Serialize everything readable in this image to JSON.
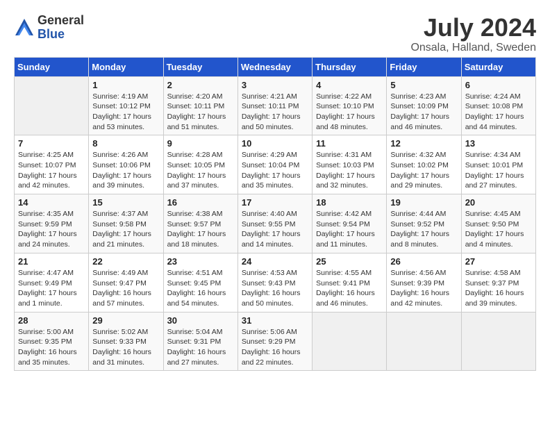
{
  "logo": {
    "general": "General",
    "blue": "Blue"
  },
  "title": {
    "month_year": "July 2024",
    "location": "Onsala, Halland, Sweden"
  },
  "days_of_week": [
    "Sunday",
    "Monday",
    "Tuesday",
    "Wednesday",
    "Thursday",
    "Friday",
    "Saturday"
  ],
  "weeks": [
    [
      {
        "day": "",
        "info": ""
      },
      {
        "day": "1",
        "info": "Sunrise: 4:19 AM\nSunset: 10:12 PM\nDaylight: 17 hours\nand 53 minutes."
      },
      {
        "day": "2",
        "info": "Sunrise: 4:20 AM\nSunset: 10:11 PM\nDaylight: 17 hours\nand 51 minutes."
      },
      {
        "day": "3",
        "info": "Sunrise: 4:21 AM\nSunset: 10:11 PM\nDaylight: 17 hours\nand 50 minutes."
      },
      {
        "day": "4",
        "info": "Sunrise: 4:22 AM\nSunset: 10:10 PM\nDaylight: 17 hours\nand 48 minutes."
      },
      {
        "day": "5",
        "info": "Sunrise: 4:23 AM\nSunset: 10:09 PM\nDaylight: 17 hours\nand 46 minutes."
      },
      {
        "day": "6",
        "info": "Sunrise: 4:24 AM\nSunset: 10:08 PM\nDaylight: 17 hours\nand 44 minutes."
      }
    ],
    [
      {
        "day": "7",
        "info": "Sunrise: 4:25 AM\nSunset: 10:07 PM\nDaylight: 17 hours\nand 42 minutes."
      },
      {
        "day": "8",
        "info": "Sunrise: 4:26 AM\nSunset: 10:06 PM\nDaylight: 17 hours\nand 39 minutes."
      },
      {
        "day": "9",
        "info": "Sunrise: 4:28 AM\nSunset: 10:05 PM\nDaylight: 17 hours\nand 37 minutes."
      },
      {
        "day": "10",
        "info": "Sunrise: 4:29 AM\nSunset: 10:04 PM\nDaylight: 17 hours\nand 35 minutes."
      },
      {
        "day": "11",
        "info": "Sunrise: 4:31 AM\nSunset: 10:03 PM\nDaylight: 17 hours\nand 32 minutes."
      },
      {
        "day": "12",
        "info": "Sunrise: 4:32 AM\nSunset: 10:02 PM\nDaylight: 17 hours\nand 29 minutes."
      },
      {
        "day": "13",
        "info": "Sunrise: 4:34 AM\nSunset: 10:01 PM\nDaylight: 17 hours\nand 27 minutes."
      }
    ],
    [
      {
        "day": "14",
        "info": "Sunrise: 4:35 AM\nSunset: 9:59 PM\nDaylight: 17 hours\nand 24 minutes."
      },
      {
        "day": "15",
        "info": "Sunrise: 4:37 AM\nSunset: 9:58 PM\nDaylight: 17 hours\nand 21 minutes."
      },
      {
        "day": "16",
        "info": "Sunrise: 4:38 AM\nSunset: 9:57 PM\nDaylight: 17 hours\nand 18 minutes."
      },
      {
        "day": "17",
        "info": "Sunrise: 4:40 AM\nSunset: 9:55 PM\nDaylight: 17 hours\nand 14 minutes."
      },
      {
        "day": "18",
        "info": "Sunrise: 4:42 AM\nSunset: 9:54 PM\nDaylight: 17 hours\nand 11 minutes."
      },
      {
        "day": "19",
        "info": "Sunrise: 4:44 AM\nSunset: 9:52 PM\nDaylight: 17 hours\nand 8 minutes."
      },
      {
        "day": "20",
        "info": "Sunrise: 4:45 AM\nSunset: 9:50 PM\nDaylight: 17 hours\nand 4 minutes."
      }
    ],
    [
      {
        "day": "21",
        "info": "Sunrise: 4:47 AM\nSunset: 9:49 PM\nDaylight: 17 hours\nand 1 minute."
      },
      {
        "day": "22",
        "info": "Sunrise: 4:49 AM\nSunset: 9:47 PM\nDaylight: 16 hours\nand 57 minutes."
      },
      {
        "day": "23",
        "info": "Sunrise: 4:51 AM\nSunset: 9:45 PM\nDaylight: 16 hours\nand 54 minutes."
      },
      {
        "day": "24",
        "info": "Sunrise: 4:53 AM\nSunset: 9:43 PM\nDaylight: 16 hours\nand 50 minutes."
      },
      {
        "day": "25",
        "info": "Sunrise: 4:55 AM\nSunset: 9:41 PM\nDaylight: 16 hours\nand 46 minutes."
      },
      {
        "day": "26",
        "info": "Sunrise: 4:56 AM\nSunset: 9:39 PM\nDaylight: 16 hours\nand 42 minutes."
      },
      {
        "day": "27",
        "info": "Sunrise: 4:58 AM\nSunset: 9:37 PM\nDaylight: 16 hours\nand 39 minutes."
      }
    ],
    [
      {
        "day": "28",
        "info": "Sunrise: 5:00 AM\nSunset: 9:35 PM\nDaylight: 16 hours\nand 35 minutes."
      },
      {
        "day": "29",
        "info": "Sunrise: 5:02 AM\nSunset: 9:33 PM\nDaylight: 16 hours\nand 31 minutes."
      },
      {
        "day": "30",
        "info": "Sunrise: 5:04 AM\nSunset: 9:31 PM\nDaylight: 16 hours\nand 27 minutes."
      },
      {
        "day": "31",
        "info": "Sunrise: 5:06 AM\nSunset: 9:29 PM\nDaylight: 16 hours\nand 22 minutes."
      },
      {
        "day": "",
        "info": ""
      },
      {
        "day": "",
        "info": ""
      },
      {
        "day": "",
        "info": ""
      }
    ]
  ]
}
